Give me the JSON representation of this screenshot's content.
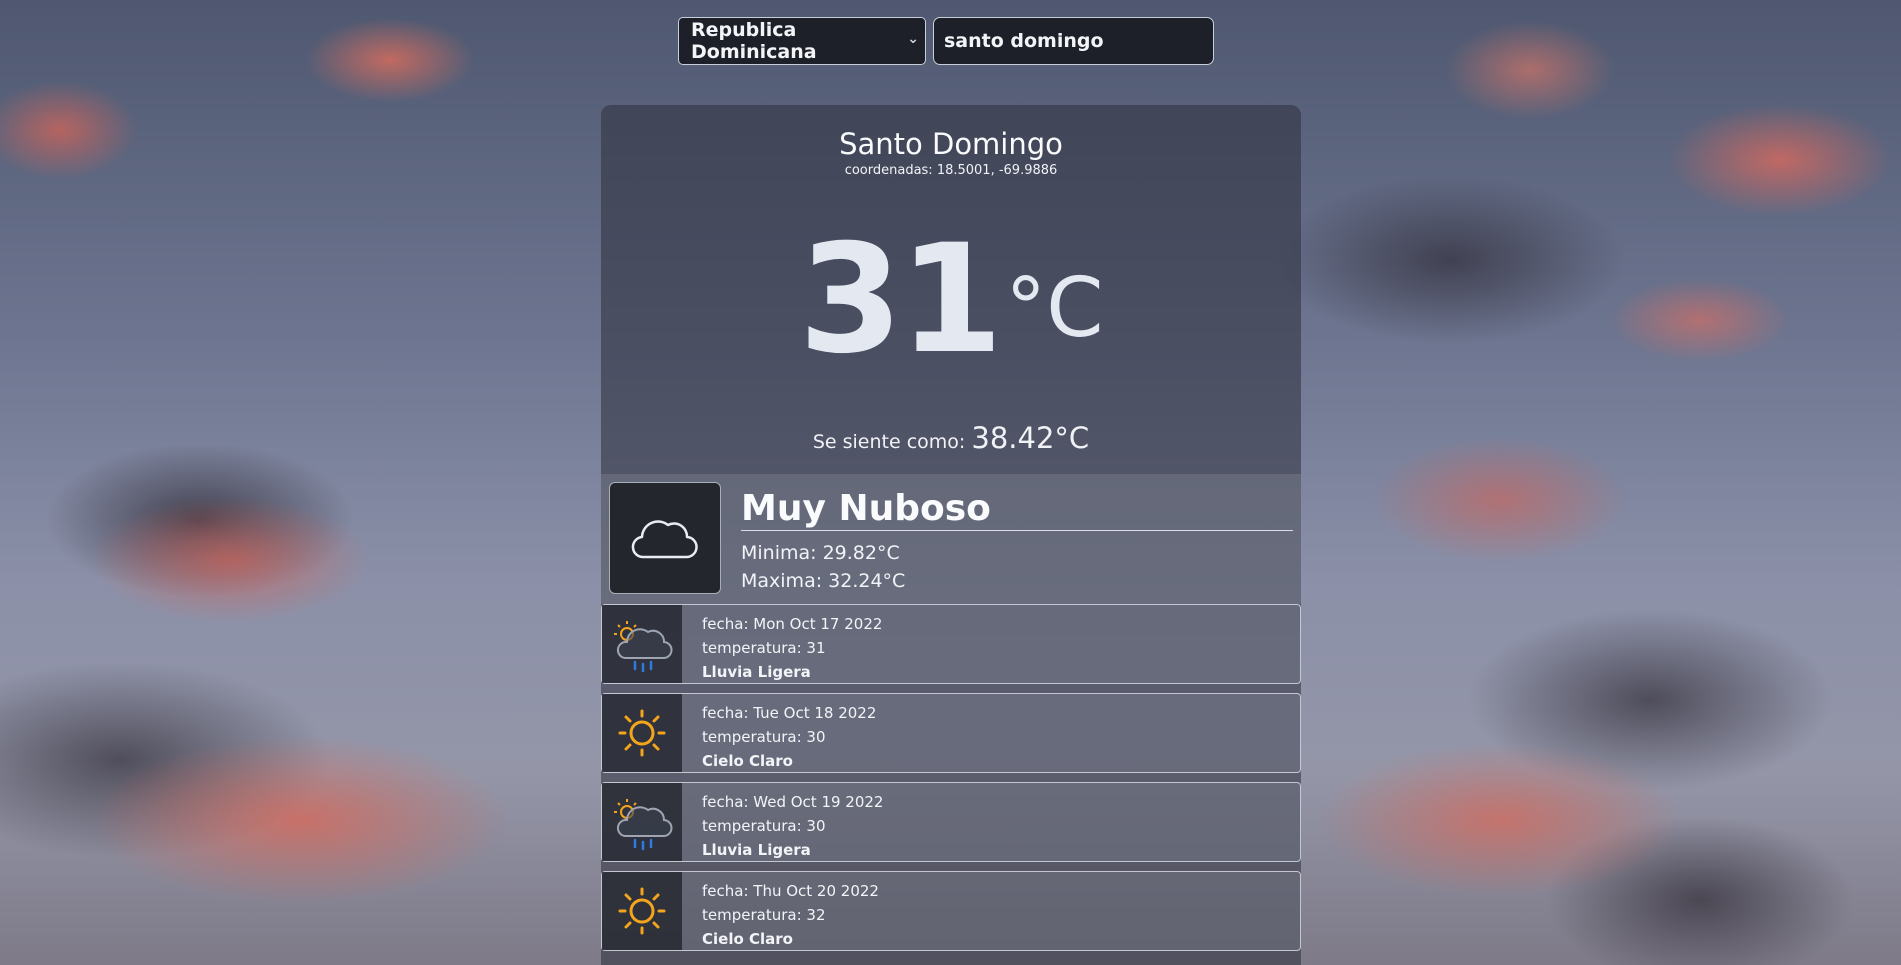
{
  "search": {
    "country": "Republica Dominicana",
    "city": "santo domingo"
  },
  "current": {
    "city": "Santo Domingo",
    "coords": "coordenadas: 18.5001, -69.9886",
    "temp": "31",
    "unit": "°C",
    "feels_label": "Se siente como:",
    "feels_value": "38.42°C",
    "icon": "cloud-icon",
    "description": "Muy Nuboso",
    "min": "Minima: 29.82°C",
    "max": "Maxima: 32.24°C"
  },
  "forecast": [
    {
      "fecha": "fecha: Mon Oct 17 2022",
      "temp": "temperatura: 31",
      "desc": "Lluvia Ligera",
      "icon": "sun-rain-cloud-icon"
    },
    {
      "fecha": "fecha: Tue Oct 18 2022",
      "temp": "temperatura: 30",
      "desc": "Cielo Claro",
      "icon": "sun-icon"
    },
    {
      "fecha": "fecha: Wed Oct 19 2022",
      "temp": "temperatura: 30",
      "desc": "Lluvia Ligera",
      "icon": "sun-rain-cloud-icon"
    },
    {
      "fecha": "fecha: Thu Oct 20 2022",
      "temp": "temperatura: 32",
      "desc": "Cielo Claro",
      "icon": "sun-icon"
    }
  ],
  "colors": {
    "panel": "#2d303c",
    "sun": "#f3a51c",
    "rain": "#2e7be0"
  }
}
